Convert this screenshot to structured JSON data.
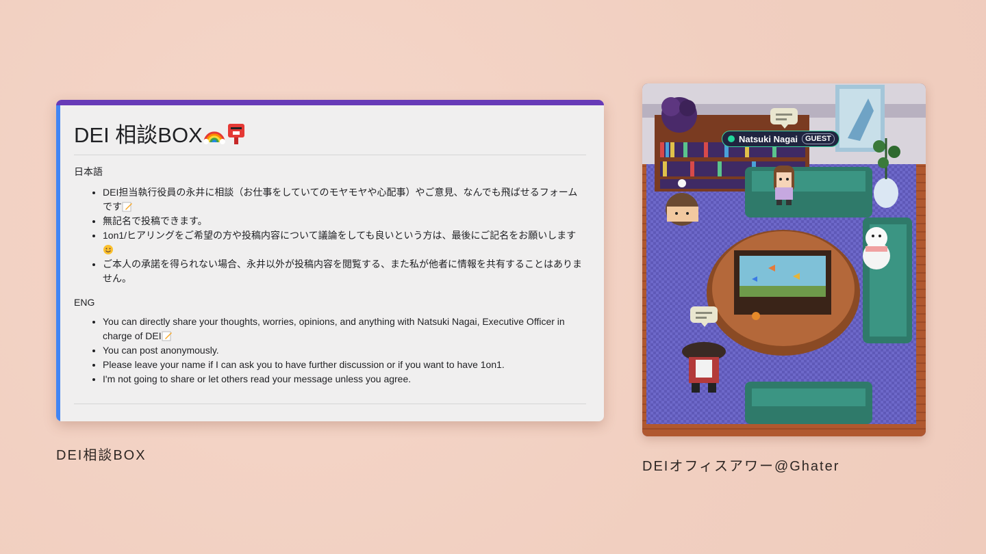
{
  "form": {
    "title": "DEI 相談BOX",
    "title_emojis": [
      "rainbow-icon",
      "postbox-icon"
    ],
    "jp_label": "日本語",
    "jp_items": [
      "DEI担当執行役員の永井に相談（お仕事をしていてのモヤモヤや心配事）やご意見、なんでも飛ばせるフォームです",
      "無記名で投稿できます。",
      "1on1/ヒアリングをご希望の方や投稿内容について議論をしても良いという方は、最後にご記名をお願いします",
      "ご本人の承諾を得られない場合、永井以外が投稿内容を閲覧する、また私が他者に情報を共有することはありません。"
    ],
    "en_label": "ENG",
    "en_items": [
      "You can directly share your thoughts, worries, opinions, and anything with Natsuki Nagai, Executive Officer in charge of DEI",
      "You can post anonymously.",
      "Please leave your name if I can ask you to have further discussion or if you want to have 1on1.",
      "I'm not going to share or let others read your message unless you agree."
    ],
    "accent_top": "#673ab7",
    "accent_left": "#4285f4"
  },
  "captions": {
    "left": "DEI相談BOX",
    "right": "DEIオフィスアワー@Ghater"
  },
  "game": {
    "player_name": "Natsuki Nagai",
    "player_badge": "GUEST",
    "status_color": "#22d69a"
  }
}
